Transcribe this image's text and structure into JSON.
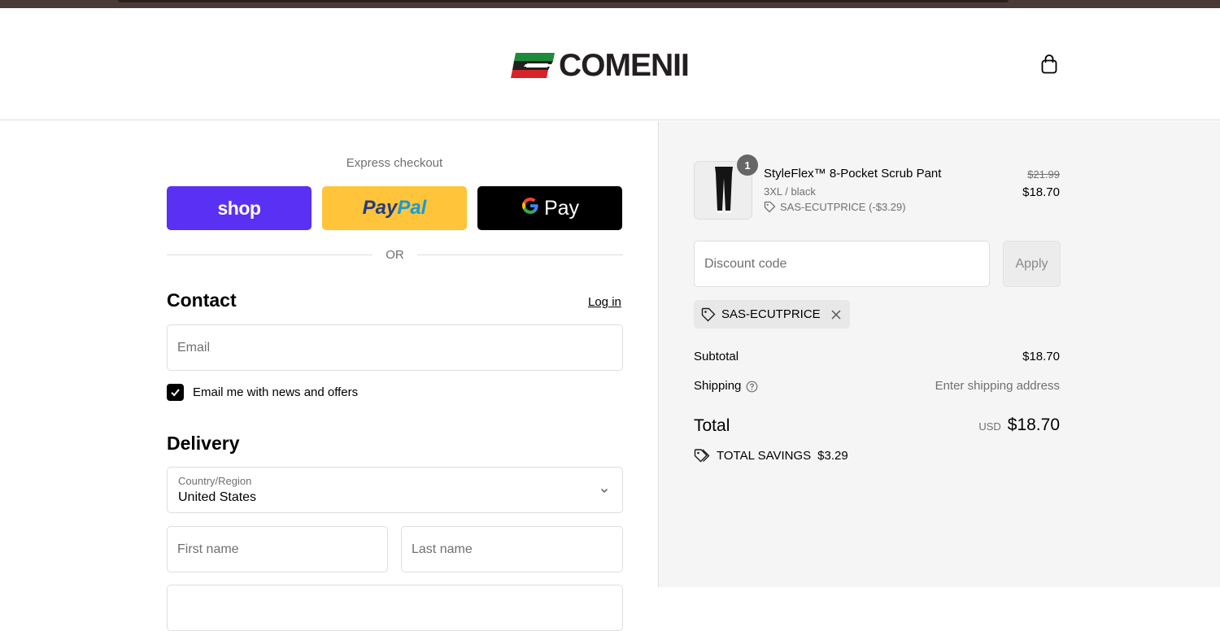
{
  "header": {
    "brand": "COMENII",
    "brand_colors": {
      "green": "#1e8a3c",
      "red": "#d8232a",
      "dark": "#231f20"
    },
    "cart_icon": "shopping-bag-icon"
  },
  "express": {
    "label": "Express checkout",
    "shop_label": "shop",
    "paypal_part1": "Pay",
    "paypal_part2": "Pal",
    "gpay_g": "G",
    "gpay_label": "Pay",
    "colors": {
      "shop": "#5a31f4",
      "paypal": "#ffc439",
      "gpay": "#000000"
    }
  },
  "divider": {
    "or_text": "OR"
  },
  "contact": {
    "title": "Contact",
    "login_link": "Log in",
    "email_placeholder": "Email",
    "newsletter_label": "Email me with news and offers",
    "newsletter_checked": true
  },
  "delivery": {
    "title": "Delivery",
    "country_label": "Country/Region",
    "country_value": "United States",
    "first_name_placeholder": "First name",
    "last_name_placeholder": "Last name"
  },
  "order": {
    "item": {
      "quantity": "1",
      "name": "StyleFlex™ 8-Pocket Scrub Pant",
      "variant": "3XL / black",
      "discount": "SAS-ECUTPRICE (-$3.29)",
      "original_price": "$21.99",
      "price": "$18.70"
    },
    "discount_placeholder": "Discount code",
    "apply_label": "Apply",
    "applied_code": "SAS-ECUTPRICE",
    "subtotal_label": "Subtotal",
    "subtotal_value": "$18.70",
    "shipping_label": "Shipping",
    "shipping_value": "Enter shipping address",
    "total_label": "Total",
    "total_currency": "USD",
    "total_value": "$18.70",
    "savings_label": "TOTAL SAVINGS",
    "savings_value": "$3.29"
  }
}
